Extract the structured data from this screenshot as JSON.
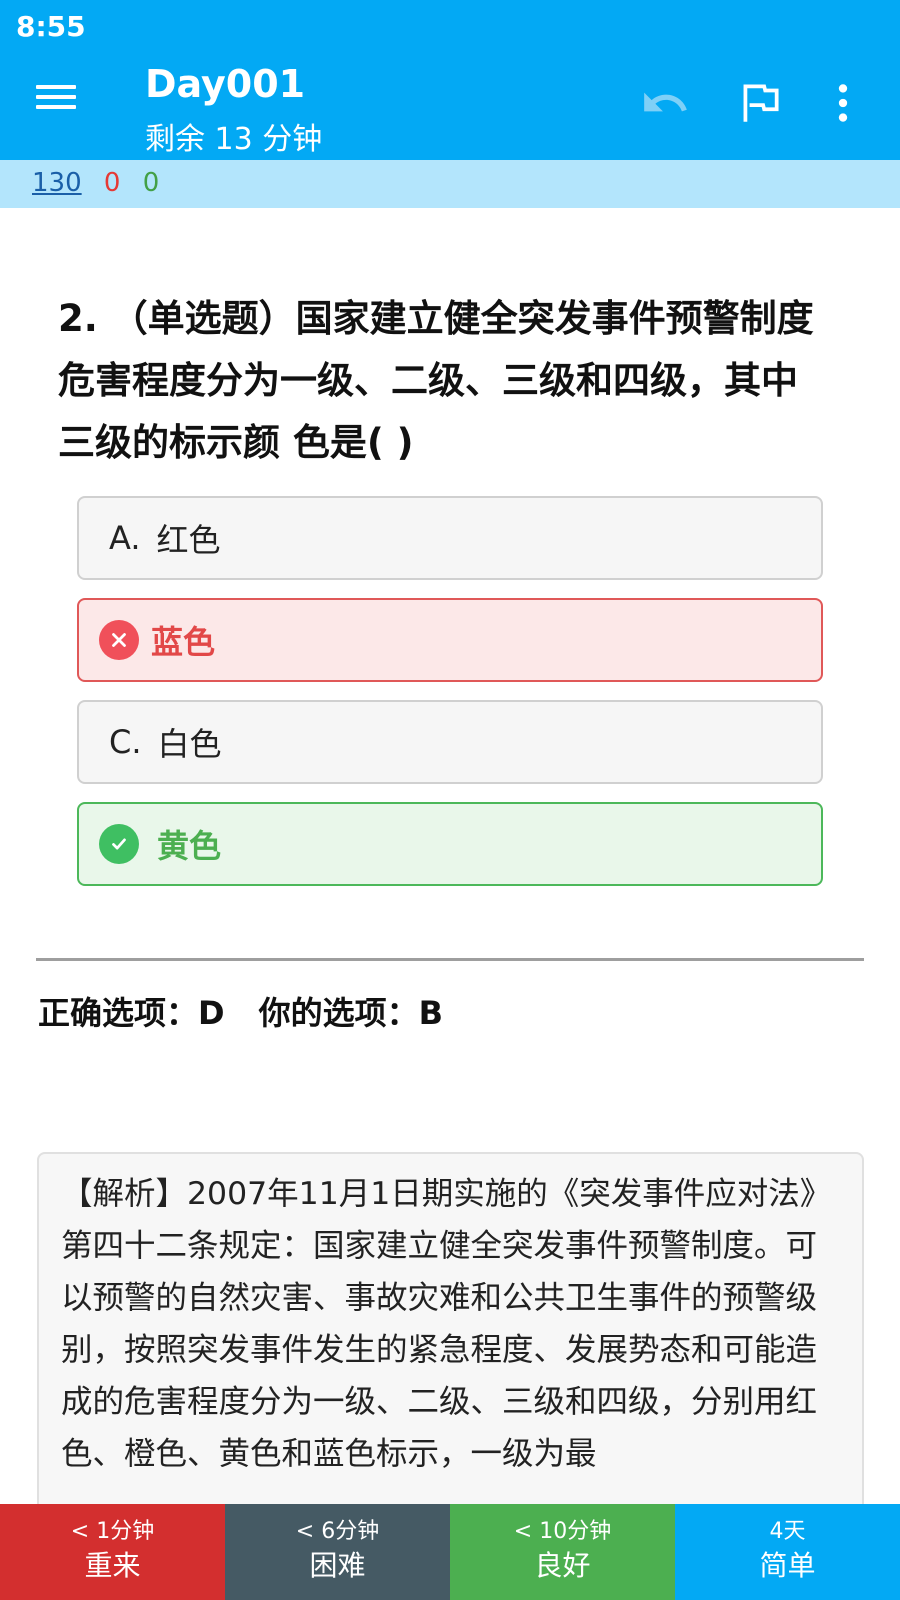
{
  "status_bar": {
    "time": "8:55"
  },
  "app_bar": {
    "title": "Day001",
    "subtitle": "剩余 13 分钟",
    "icons": [
      "menu-icon",
      "undo-icon",
      "flag-icon",
      "more-vert-icon"
    ]
  },
  "counts": {
    "total": "130",
    "wrong": "0",
    "right": "0"
  },
  "question": {
    "text": "2. （单选题）国家建立健全突发事件预警制度危害程度分为一级、二级、三级和四级，其中三级的标示颜 色是( )"
  },
  "options": [
    {
      "letter": "A.",
      "text": "红色",
      "state": "normal"
    },
    {
      "letter": "",
      "text": "蓝色",
      "state": "wrong",
      "icon": "close-icon"
    },
    {
      "letter": "C.",
      "text": "白色",
      "state": "normal"
    },
    {
      "letter": "",
      "text": "黄色",
      "state": "correct",
      "icon": "check-icon"
    }
  ],
  "answer": {
    "correct_label": "正确选项：D",
    "yours_label": "你的选项：B"
  },
  "analysis": {
    "text": "【解析】2007年11月1日期实施的《突发事件应对法》第四十二条规定：国家建立健全突发事件预警制度。可以预警的自然灾害、事故灾难和公共卫生事件的预警级别，按照突发事件发生的紧急程度、发展势态和可能造成的危害程度分为一级、二级、三级和四级，分别用红色、橙色、黄色和蓝色标示，一级为最"
  },
  "bottom_buttons": [
    {
      "time": "< 1分钟",
      "label": "重来",
      "color": "#d32f2f"
    },
    {
      "time": "< 6分钟",
      "label": "困难",
      "color": "#455a64"
    },
    {
      "time": "< 10分钟",
      "label": "良好",
      "color": "#4caf50"
    },
    {
      "time": "4天",
      "label": "简单",
      "color": "#03a9f4"
    }
  ],
  "colors": {
    "primary": "#03a9f4",
    "counts_bar": "#b3e5fc",
    "wrong": "#e24848",
    "correct": "#4caf50"
  }
}
